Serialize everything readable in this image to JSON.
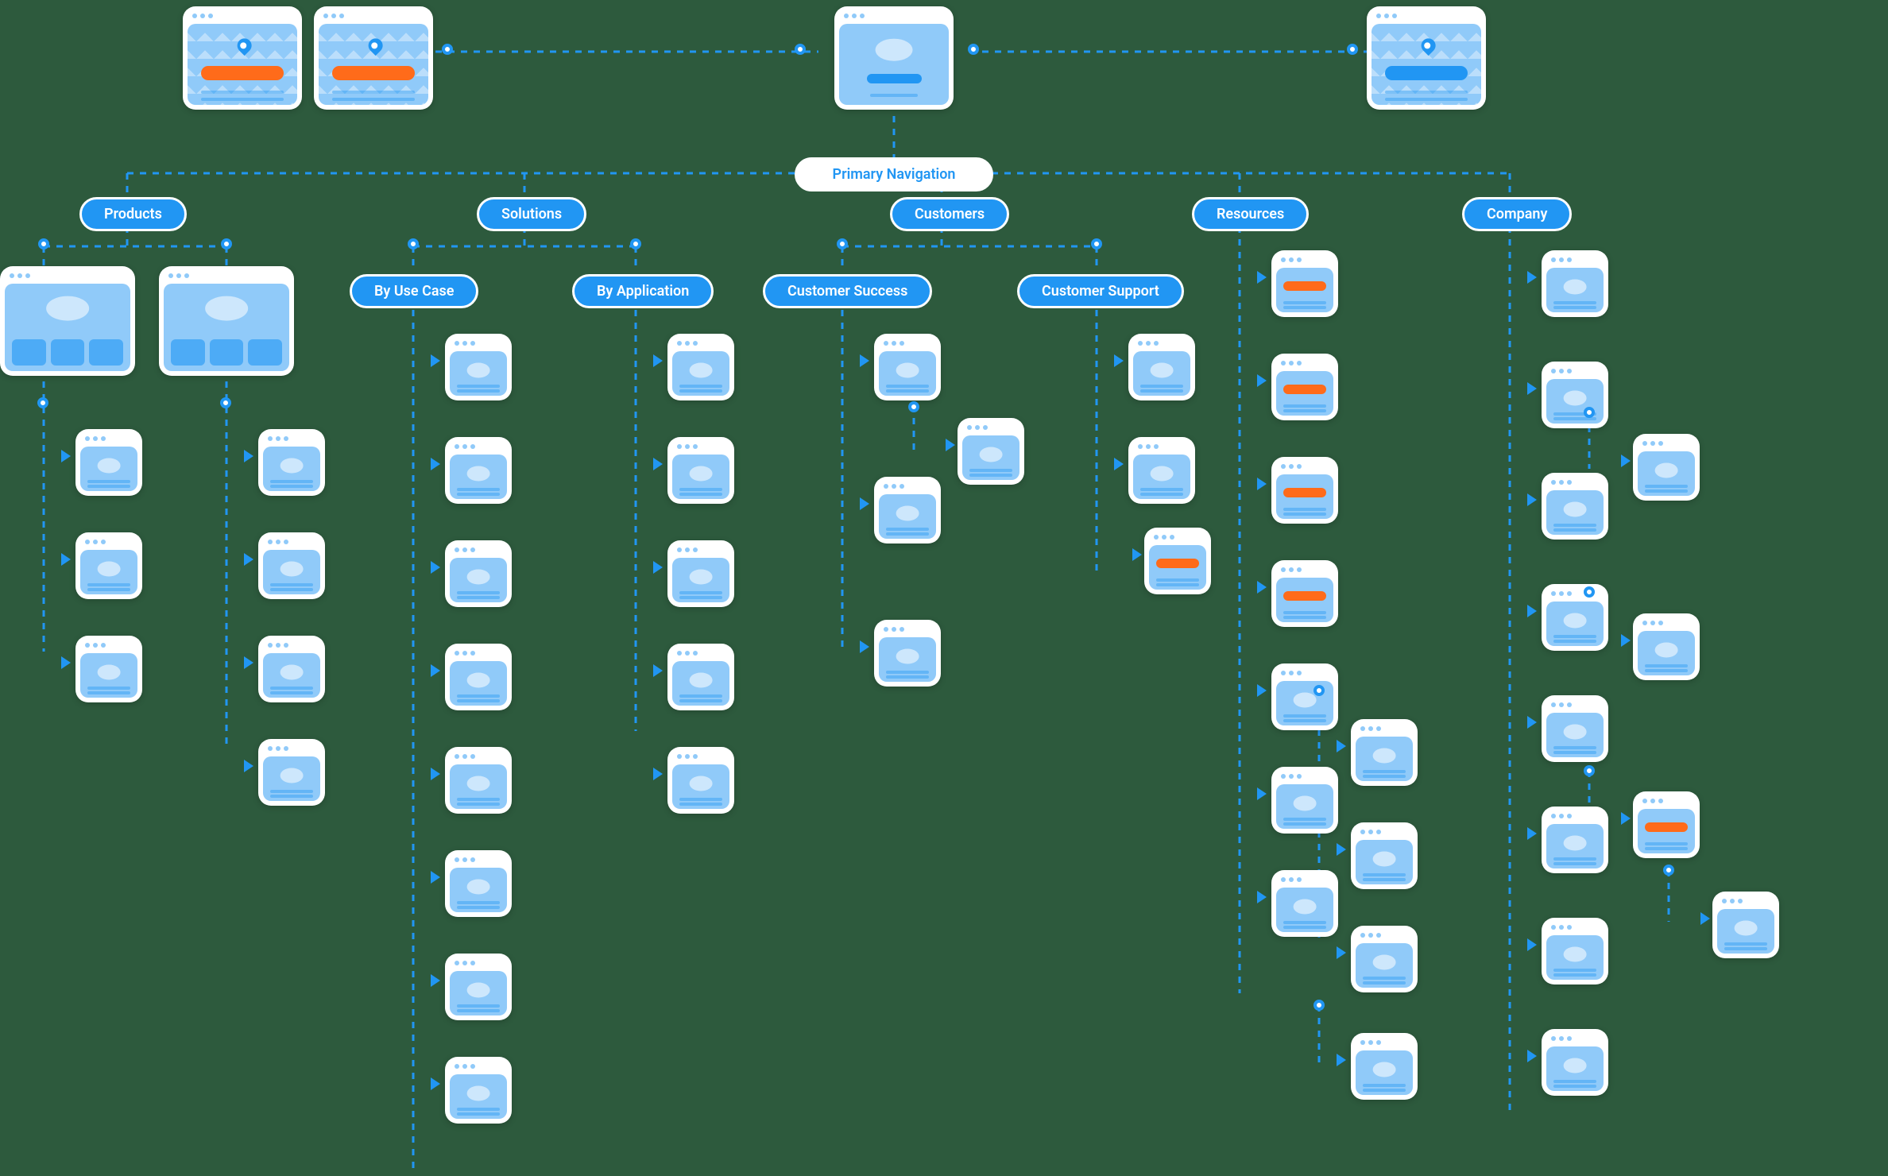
{
  "diagram": {
    "title": "Primary Navigation",
    "top_row": {
      "left_landing_a": {
        "kind": "map",
        "band": "orange"
      },
      "left_landing_b": {
        "kind": "map",
        "band": "orange"
      },
      "center_app": {
        "kind": "app",
        "band": "blue"
      },
      "right_landing": {
        "kind": "map",
        "band": "blue"
      }
    },
    "primary_nav_label": "Primary Navigation",
    "sections": [
      {
        "id": "products",
        "label": "Products"
      },
      {
        "id": "solutions",
        "label": "Solutions"
      },
      {
        "id": "customers",
        "label": "Customers"
      },
      {
        "id": "resources",
        "label": "Resources"
      },
      {
        "id": "company",
        "label": "Company"
      }
    ],
    "solutions_subnav": [
      {
        "id": "by-use-case",
        "label": "By Use Case"
      },
      {
        "id": "by-application",
        "label": "By Application"
      }
    ],
    "customers_subnav": [
      {
        "id": "customer-success",
        "label": "Customer Success"
      },
      {
        "id": "customer-support",
        "label": "Customer Support"
      }
    ],
    "products": {
      "hubs": [
        {
          "kind": "gallery"
        },
        {
          "kind": "gallery"
        }
      ],
      "col_a_pages": 3,
      "col_b_pages": 4
    },
    "solutions": {
      "by_use_case_pages": 8,
      "by_application_pages": 5
    },
    "customers": {
      "success": {
        "pages": 3,
        "sub_page": true
      },
      "support": {
        "pages": 2,
        "extra_orange": true
      }
    },
    "resources": {
      "column": [
        {
          "kind": "orange"
        },
        {
          "kind": "orange"
        },
        {
          "kind": "orange"
        },
        {
          "kind": "orange"
        },
        {
          "kind": "cloud"
        },
        {
          "kind": "cloud",
          "sub": [
            {
              "kind": "cloud"
            },
            {
              "kind": "cloud"
            },
            {
              "kind": "cloud"
            }
          ]
        },
        {
          "kind": "cloud",
          "sub": [
            {
              "kind": "cloud"
            }
          ]
        }
      ]
    },
    "company": {
      "column": [
        {
          "kind": "cloud"
        },
        {
          "kind": "cloud"
        },
        {
          "kind": "cloud",
          "sub": [
            {
              "kind": "cloud"
            }
          ]
        },
        {
          "kind": "cloud"
        },
        {
          "kind": "cloud",
          "sub": [
            {
              "kind": "cloud"
            }
          ]
        },
        {
          "kind": "cloud"
        },
        {
          "kind": "cloud",
          "sub": [
            {
              "kind": "orange",
              "sub": [
                {
                  "kind": "cloud"
                }
              ]
            }
          ]
        },
        {
          "kind": "cloud"
        }
      ]
    }
  },
  "colors": {
    "background": "#2d5a3d",
    "blue": "#2196f3",
    "orange": "#ff6b1a",
    "white": "#ffffff"
  }
}
